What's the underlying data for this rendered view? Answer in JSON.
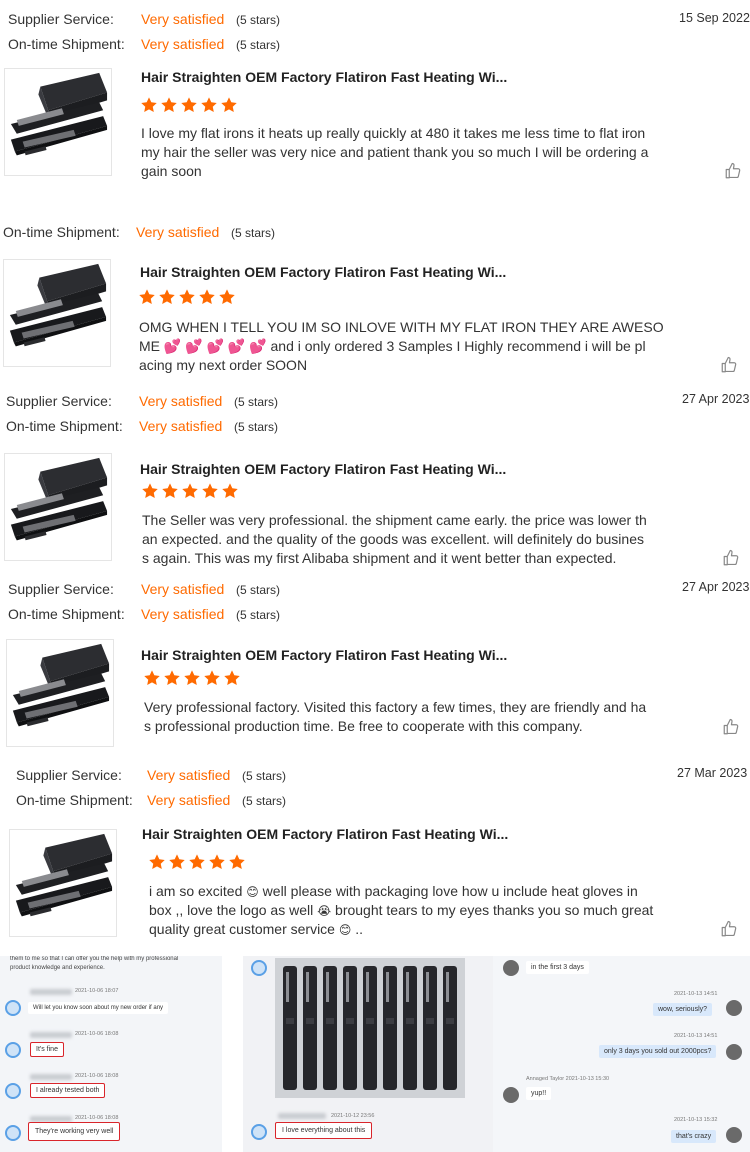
{
  "colors": {
    "accent": "#ff6a00",
    "text": "#333333",
    "highlight_border": "#d9252b"
  },
  "labels": {
    "supplier_service": "Supplier Service:",
    "ontime_shipment": "On-time Shipment:",
    "very_satisfied": "Very satisfied",
    "five_stars": "(5 stars)"
  },
  "product_title": "Hair Straighten OEM Factory Flatiron Fast Heating Wi...",
  "star_rating": 5,
  "reviews": [
    {
      "date": "15 Sep 2022",
      "text_lines": [
        "I love my flat irons it heats up really quickly at 480 it takes me less time to flat iron",
        "my hair the seller was very nice and patient thank you so much I will be ordering a",
        "gain soon"
      ]
    },
    {
      "date": "",
      "text_lines": [
        "OMG WHEN I TELL YOU IM SO INLOVE WITH MY FLAT IRON THEY   ARE AWESO",
        "ME",
        "and i only ordered 3  Samples  I Highly recommend i will be pl",
        "acing my next order SOON"
      ]
    },
    {
      "date": "27 Apr 2023",
      "text_lines": [
        "The Seller was very professional. the shipment came early. the price was lower th",
        "an expected. and the quality of the goods was excellent. will definitely do busines",
        "s again. This was my first Alibaba shipment and it went better than expected."
      ]
    },
    {
      "date": "27 Apr 2023",
      "text_lines": [
        "Very professional factory. Visited this factory a few times, they are friendly and ha",
        "s professional production time. Be free to cooperate with this company."
      ]
    },
    {
      "date": "27 Mar 2023",
      "text_lines": [
        "i am so excited",
        "well please with packaging love how u include  heat gloves in",
        "box ,, love the logo as well",
        "brought tears to my eyes thanks you so much great",
        "quality great customer service",
        ".."
      ]
    }
  ],
  "chat": {
    "left": {
      "top_text_1": "them to me so that I can offer you the help with my professional",
      "top_text_2": "product knowledge and experience.",
      "messages": [
        {
          "time": "2021-10-06 18:07",
          "text": "Will let you know soon about my new order if any"
        },
        {
          "time": "2021-10-06 18:08",
          "text": "It's fine"
        },
        {
          "time": "2021-10-06 18:08",
          "text": "I already tested both"
        },
        {
          "time": "2021-10-06 18:08",
          "text": "They're working very well"
        }
      ]
    },
    "middle": {
      "time": "2021-10-12 23:56",
      "text": "I love everything about this"
    },
    "right": {
      "messages": [
        {
          "time": "",
          "text": "in the first 3 days"
        },
        {
          "time": "2021-10-13 14:51",
          "text": "wow,   seriously?"
        },
        {
          "time": "2021-10-13 14:51",
          "text": "only 3 days you sold out 2000pcs?"
        },
        {
          "time": "Annaged Taylor   2021-10-13 15:30",
          "text": "yup!!"
        },
        {
          "time": "2021-10-13 15:32",
          "text": "that's crazy"
        }
      ]
    }
  }
}
